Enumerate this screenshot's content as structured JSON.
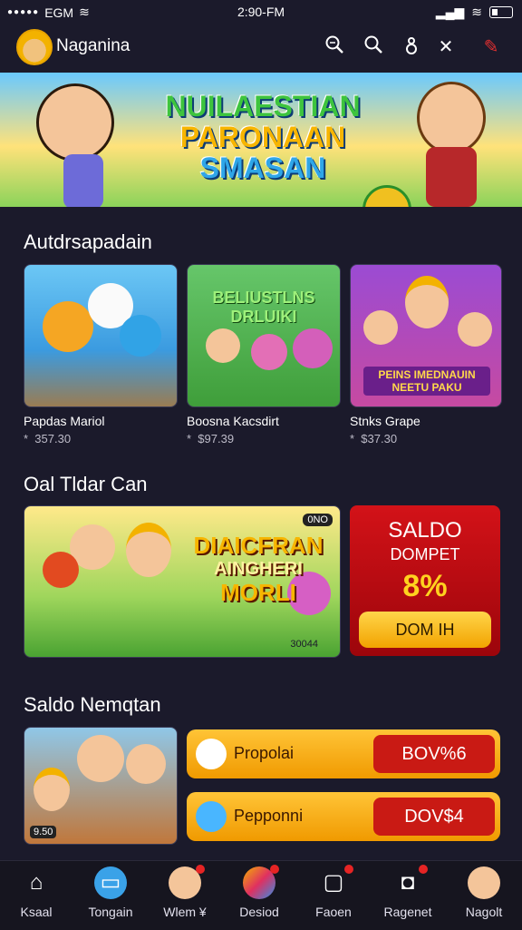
{
  "status": {
    "carrier": "EGM",
    "time": "2:90-FM"
  },
  "header": {
    "title": "Naganina"
  },
  "icons": {
    "search": "search-icon",
    "search2": "magnifier-icon",
    "user": "user-icon",
    "close": "close-icon",
    "edit": "pen-icon"
  },
  "banner": {
    "line1": "NUILAESTIAN",
    "line2": "PARONAAN",
    "line3": "SMASAN"
  },
  "section1": {
    "title": "Autdrsapadain",
    "cards": [
      {
        "name": "Papdas Mariol",
        "price": "357.30",
        "overlay": ""
      },
      {
        "name": "Boosna Kacsdirt",
        "price": "$97.39",
        "overlay": "BELIUSTLNS DRLUIKI"
      },
      {
        "name": "Stnks Grape",
        "price": "$37.30",
        "overlay": "PEINS IMEDNAUIN NEETU PAKU"
      }
    ]
  },
  "section2": {
    "title": "Oal Tldar Can",
    "feature": {
      "line1": "DIAICFRAN",
      "line2": "AINGHERI",
      "line3": "MORLI",
      "tag": "0NO",
      "counter": "30044"
    },
    "saldo": {
      "title": "SALDO",
      "subtitle": "DOMPET",
      "percent": "8%",
      "button": "DOM IH"
    }
  },
  "section3": {
    "title": "Saldo Nemqtan",
    "thumb_price": "9.50",
    "items": [
      {
        "label": "Propolai",
        "value": "BOV%6"
      },
      {
        "label": "Pepponni",
        "value": "DOV$4"
      }
    ]
  },
  "nav": [
    {
      "label": "Ksaal"
    },
    {
      "label": "Tongain"
    },
    {
      "label": "Wlem ¥"
    },
    {
      "label": "Desiod"
    },
    {
      "label": "Faoen"
    },
    {
      "label": "Ragenet"
    },
    {
      "label": "Nagolt"
    }
  ]
}
